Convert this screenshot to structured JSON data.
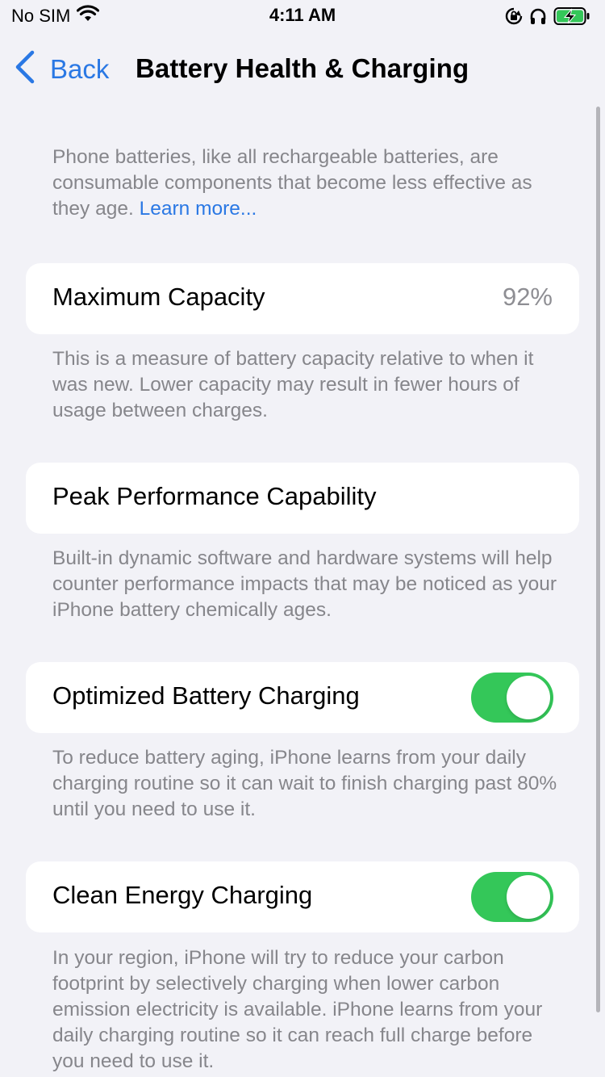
{
  "status_bar": {
    "carrier": "No SIM",
    "time": "4:11 AM"
  },
  "nav": {
    "back_label": "Back",
    "title": "Battery Health & Charging"
  },
  "intro": {
    "text": "Phone batteries, like all rechargeable batteries, are consumable components that become less effective as they age.",
    "link": "Learn more..."
  },
  "maximum_capacity": {
    "label": "Maximum Capacity",
    "value": "92%",
    "description": "This is a measure of battery capacity relative to when it was new. Lower capacity may result in fewer hours of usage between charges."
  },
  "peak_performance": {
    "label": "Peak Performance Capability",
    "description": "Built-in dynamic software and hardware systems will help counter performance impacts that may be noticed as your iPhone battery chemically ages."
  },
  "optimized_charging": {
    "label": "Optimized Battery Charging",
    "enabled": true,
    "description": "To reduce battery aging, iPhone learns from your daily charging routine so it can wait to finish charging past 80% until you need to use it."
  },
  "clean_energy": {
    "label": "Clean Energy Charging",
    "enabled": true,
    "description": "In your region, iPhone will try to reduce your carbon footprint by selectively charging when lower carbon emission electricity is available. iPhone learns from your daily charging routine so it can reach full charge before you need to use it."
  },
  "colors": {
    "accent": "#2a78e4",
    "toggle_on": "#34c759",
    "background": "#f2f2f7",
    "secondary_text": "#86868b"
  },
  "icons": {
    "wifi": "wifi-icon",
    "orientation_lock": "orientation-lock-icon",
    "headphones": "headphones-icon",
    "battery": "battery-charging-icon",
    "back": "chevron-left-icon"
  }
}
